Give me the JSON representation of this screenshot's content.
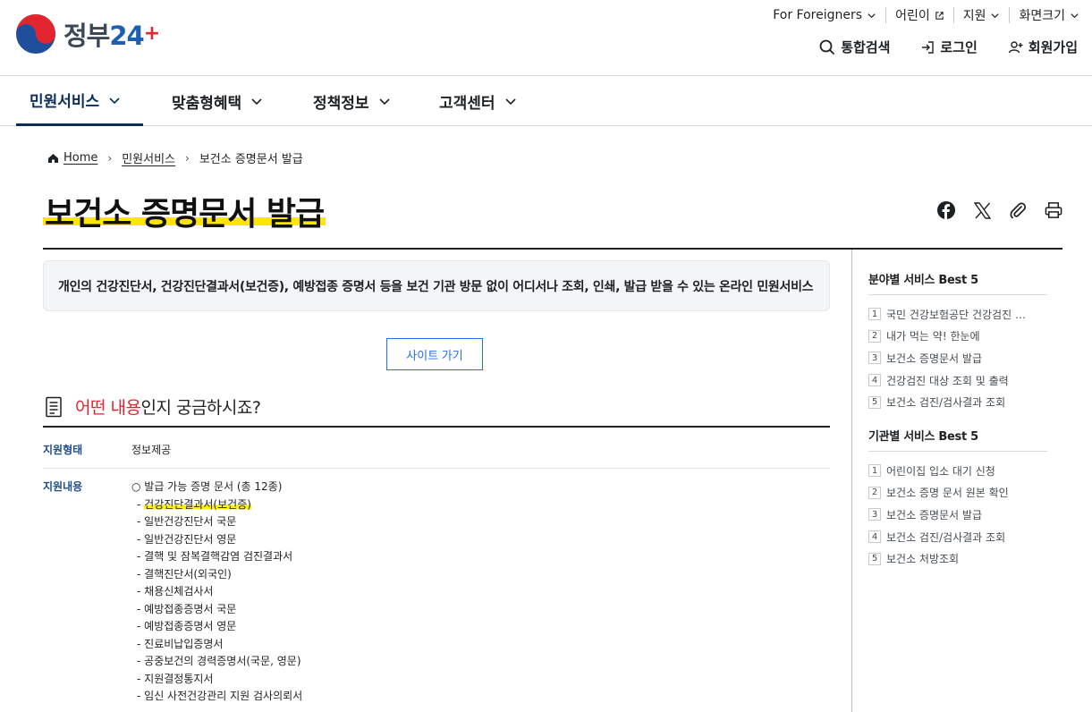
{
  "header": {
    "logo_text": "정부24",
    "util_links": [
      {
        "label": "For Foreigners",
        "icon": "chevron-down-icon"
      },
      {
        "label": "어린이",
        "icon": "external-link-icon"
      },
      {
        "label": "지원",
        "icon": "chevron-down-icon"
      },
      {
        "label": "화면크기",
        "icon": "chevron-down-icon"
      }
    ],
    "member_links": [
      {
        "label": "통합검색",
        "icon": "search-icon"
      },
      {
        "label": "로그인",
        "icon": "login-icon"
      },
      {
        "label": "회원가입",
        "icon": "user-add-icon"
      }
    ]
  },
  "gnb": {
    "items": [
      {
        "label": "민원서비스",
        "active": true
      },
      {
        "label": "맞춤형혜택",
        "active": false
      },
      {
        "label": "정책정보",
        "active": false
      },
      {
        "label": "고객센터",
        "active": false
      }
    ]
  },
  "breadcrumb": {
    "home": "Home",
    "level1": "민원서비스",
    "current": "보건소 증명문서 발급"
  },
  "page": {
    "title": "보건소 증명문서 발급",
    "share_icons": [
      "facebook-icon",
      "x-icon",
      "link-copy-icon",
      "print-icon"
    ],
    "summary": "개인의 건강진단서, 건강진단결과서(보건증), 예방접종 증명서 등을 보건 기관 방문 없이 어디서나 조회, 인쇄, 발급 받을 수 있는 온라인 민원서비스",
    "site_button": "사이트 가기",
    "section_title_red": "어떤 내용",
    "section_title_rest": "인지 궁금하시죠?",
    "rows": {
      "type_label": "지원형태",
      "type_value": "정보제공",
      "content_label": "지원내용",
      "content_head": "○ 발급 가능 증명 문서 (총 12종)",
      "documents": [
        "건강진단결과서(보건증)",
        "일반건강진단서 국문",
        "일반건강진단서 영문",
        "결핵 및 잠복결핵감염 검진결과서",
        "결핵진단서(외국인)",
        "채용신체검사서",
        "예방접종증명서 국문",
        "예방접종증명서 영문",
        "진료비납입증명서",
        "공중보건의 경력증명서(국문, 영문)",
        "지원결정통지서",
        "임신 사전건강관리 지원 검사의뢰서"
      ]
    }
  },
  "sidebar": {
    "field_best": {
      "title": "분야별 서비스 Best 5",
      "items": [
        {
          "rank": "1",
          "label": "국민 건강보험공단 건강검진 결과조회"
        },
        {
          "rank": "2",
          "label": "내가 먹는 약! 한눈에"
        },
        {
          "rank": "3",
          "label": "보건소 증명문서 발급"
        },
        {
          "rank": "4",
          "label": "건강검진 대상 조회 및 출력"
        },
        {
          "rank": "5",
          "label": "보건소 검진/검사결과 조회"
        }
      ]
    },
    "org_best": {
      "title": "기관별 서비스 Best 5",
      "items": [
        {
          "rank": "1",
          "label": "어린이집 입소 대기 신청"
        },
        {
          "rank": "2",
          "label": "보건소 증명 문서 원본 확인"
        },
        {
          "rank": "3",
          "label": "보건소 증명문서 발급"
        },
        {
          "rank": "4",
          "label": "보건소 검진/검사결과 조회"
        },
        {
          "rank": "5",
          "label": "보건소 처방조회"
        }
      ]
    }
  }
}
